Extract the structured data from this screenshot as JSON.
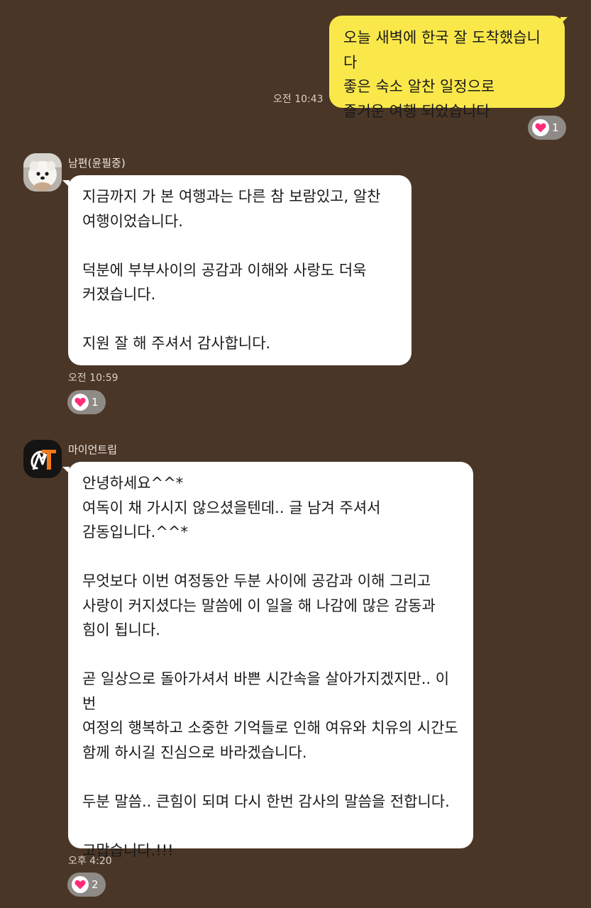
{
  "messages": [
    {
      "sender": "me",
      "text": "오늘 새벽에 한국 잘 도착했습니다\n좋은 숙소 알찬 일정으로\n즐거운 여행 되었습니다",
      "time": "오전 10:43",
      "reaction_count": "1"
    },
    {
      "sender": "other",
      "name": "남편(윤필중)",
      "avatar": "dog-avatar",
      "text": "지금까지 가 본 여행과는 다른 참 보람있고, 알찬\n여행이었습니다.\n\n덕분에 부부사이의 공감과 이해와 사랑도 더욱\n커졌습니다.\n\n지원 잘 해 주셔서 감사합니다.",
      "time": "오전 10:59",
      "reaction_count": "1"
    },
    {
      "sender": "other",
      "name": "마이언트립",
      "avatar": "mt-logo-avatar",
      "text": "안녕하세요^^*\n여독이 채 가시지 않으셨을텐데.. 글 남겨 주셔서\n감동입니다.^^*\n\n무엇보다 이번 여정동안 두분 사이에 공감과 이해 그리고\n사랑이 커지셨다는 말씀에 이 일을 해 나감에 많은 감동과\n힘이 됩니다.\n\n곧 일상으로 돌아가셔서 바쁜 시간속을 살아가지겠지만.. 이번\n여정의 행복하고 소중한 기억들로 인해 여유와 치유의 시간도\n함께 하시길 진심으로 바라겠습니다.\n\n두분 말씀.. 큰힘이 되며 다시 한번 감사의 말씀을 전합니다.\n\n고맙습니다.!!!",
      "time": "오후 4:20",
      "reaction_count": "2"
    }
  ],
  "colors": {
    "background": "#4a3627",
    "my_bubble": "#fae84b",
    "other_bubble": "#ffffff",
    "heart": "#ff2d78",
    "reaction_pill": "#8e8a86"
  }
}
